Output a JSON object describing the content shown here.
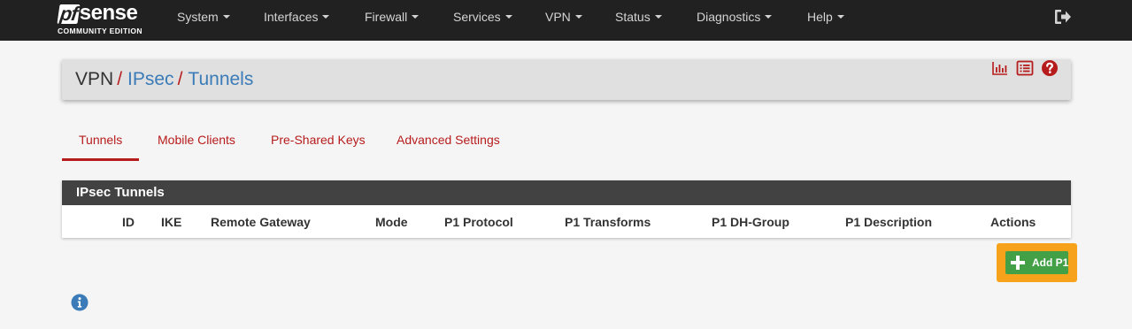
{
  "brand": {
    "logo_pf": "pf",
    "logo_sense": "sense",
    "edition": "COMMUNITY EDITION"
  },
  "nav": {
    "items": [
      {
        "label": "System"
      },
      {
        "label": "Interfaces"
      },
      {
        "label": "Firewall"
      },
      {
        "label": "Services"
      },
      {
        "label": "VPN"
      },
      {
        "label": "Status"
      },
      {
        "label": "Diagnostics"
      },
      {
        "label": "Help"
      }
    ],
    "logout_icon": "logout-icon"
  },
  "breadcrumb": {
    "root": "VPN",
    "level1": "IPsec",
    "level2": "Tunnels",
    "separator": "/",
    "icons": [
      "chart-icon",
      "list-icon",
      "help-icon"
    ]
  },
  "tabs": [
    {
      "label": "Tunnels",
      "active": true
    },
    {
      "label": "Mobile Clients",
      "active": false
    },
    {
      "label": "Pre-Shared Keys",
      "active": false
    },
    {
      "label": "Advanced Settings",
      "active": false
    }
  ],
  "table": {
    "title": "IPsec Tunnels",
    "columns": [
      "ID",
      "IKE",
      "Remote Gateway",
      "Mode",
      "P1 Protocol",
      "P1 Transforms",
      "P1 DH-Group",
      "P1 Description",
      "Actions"
    ],
    "rows": []
  },
  "actions": {
    "add_p1_label": "Add P1"
  },
  "colors": {
    "navbar": "#212121",
    "accent_red": "#b71c1c",
    "link_blue": "#3a7bb8",
    "button_green": "#43a047",
    "highlight_orange": "#f7a21b",
    "panel_header": "#424242"
  }
}
